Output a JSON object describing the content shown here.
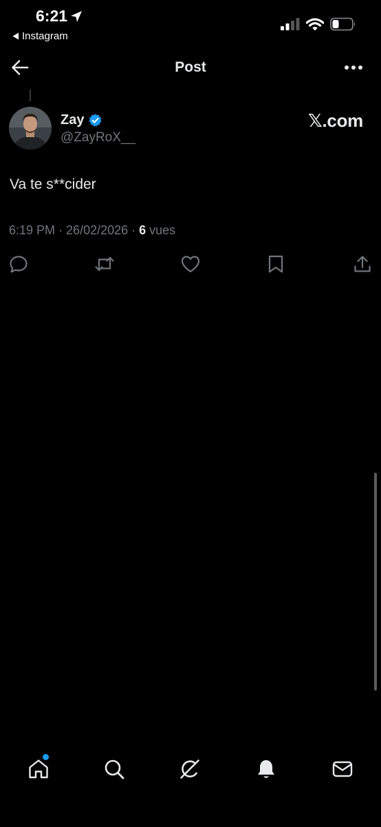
{
  "status_bar": {
    "time": "6:21",
    "back_app": "Instagram",
    "icons": [
      "location-arrow-icon",
      "cellular-signal-icon",
      "wifi-icon",
      "battery-icon"
    ]
  },
  "nav": {
    "title": "Post",
    "icons": [
      "back-arrow-icon",
      "more-dots-icon"
    ]
  },
  "post": {
    "display_name": "Zay",
    "handle": "@ZayRoX__",
    "verified": true,
    "site_brand": "𝕏.com",
    "text": "Va te s**cider",
    "time": "6:19 PM",
    "separator": " · ",
    "date": "26/02/2026",
    "views_count": "6",
    "views_label": " vues"
  },
  "actions": [
    "reply-icon",
    "repost-icon",
    "like-icon",
    "bookmark-icon",
    "share-icon"
  ],
  "tab_bar": {
    "tabs": [
      "home-icon",
      "search-icon",
      "grok-icon",
      "notifications-icon",
      "messages-icon"
    ],
    "home_has_new": true
  },
  "colors": {
    "background": "#000000",
    "text": "#e7e9ea",
    "secondary_text": "#71767b",
    "accent": "#1d9bf0"
  }
}
